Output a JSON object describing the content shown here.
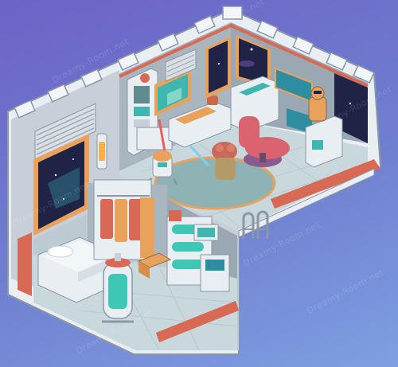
{
  "scene": {
    "watermark_text": "Dreamy-Room.net",
    "colors": {
      "background_top": "#6d63c7",
      "background_bottom": "#7f9fe0",
      "hull_white": "#e9eef3",
      "floor": "#c9d8dc",
      "floor_tile": "#b8cace",
      "wall_back": "#a9b6c0",
      "accent_red": "#d86a55",
      "accent_orange": "#e8a25b",
      "screen_teal": "#3fb7b0",
      "space_dark": "#1f2447",
      "chair_pink": "#d9646f",
      "tank_liquid": "#3fc7b6"
    },
    "objects": [
      "ribbed-wall-panel-icon",
      "space-window-left-icon",
      "wall-lamp-left-icon",
      "server-tower-icon",
      "lightsaber-rack-icon",
      "holo-screen-icon",
      "workbench-icon",
      "space-window-back-icon",
      "control-console-icon",
      "captain-chair-icon",
      "robot-droid-icon",
      "yoda-figure-icon",
      "r2-droid-icon",
      "bed-icon",
      "wardrobe-icon",
      "cryo-tank-icon",
      "capsule-rack-icon",
      "wall-terminal-icon",
      "ladder-icon"
    ]
  }
}
